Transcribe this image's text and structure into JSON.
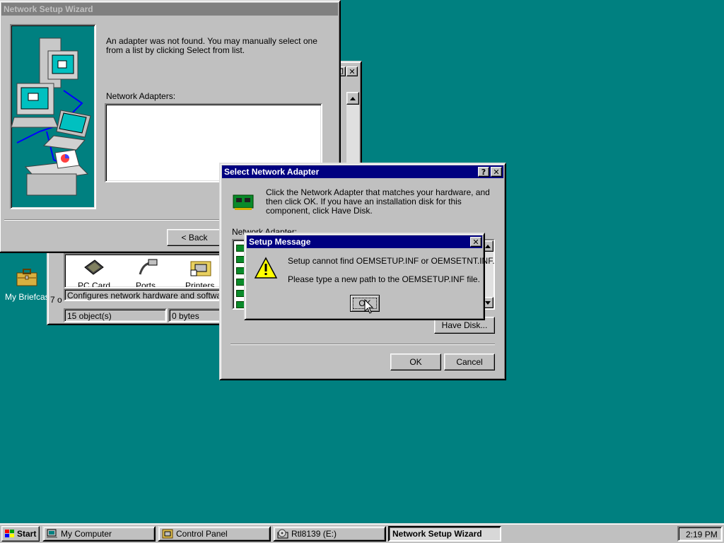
{
  "desktop": {
    "briefcase_label": "My Briefcase"
  },
  "control_panel": {
    "items": [
      "PC Card",
      "Ports",
      "Printers"
    ],
    "status_hint": "Configures network hardware and software",
    "status_partial": "7 o",
    "status_objects": "15 object(s)",
    "status_bytes": "0 bytes"
  },
  "wizard": {
    "title": "Network Setup Wizard",
    "message": "An adapter was not found. You may manually select one from a list by clicking Select from list.",
    "adapters_label": "Network Adapters:",
    "back_label": "< Back"
  },
  "select_adapter": {
    "title": "Select Network Adapter",
    "help_btn": "?",
    "close_btn": "✕",
    "instructions": "Click the Network Adapter that matches your hardware, and then click OK.  If you have an installation disk for this component, click Have Disk.",
    "adapter_label": "Network Adapter:",
    "have_disk_label": "Have Disk...",
    "ok_label": "OK",
    "cancel_label": "Cancel"
  },
  "setup_message": {
    "title": "Setup Message",
    "close_btn": "✕",
    "line1": "Setup cannot find OEMSETUP.INF or OEMSETNT.INF.",
    "line2": "Please type a new path to the OEMSETUP.INF file.",
    "ok_label": "OK"
  },
  "taskbar": {
    "start_label": "Start",
    "tasks": [
      "My Computer",
      "Control Panel",
      "Rtl8139 (E:)",
      "Network Setup Wizard"
    ],
    "clock": "2:19 PM"
  },
  "colors": {
    "desktop": "#008080",
    "title_active": "#000080",
    "title_inactive": "#808080",
    "face": "#c0c0c0"
  }
}
